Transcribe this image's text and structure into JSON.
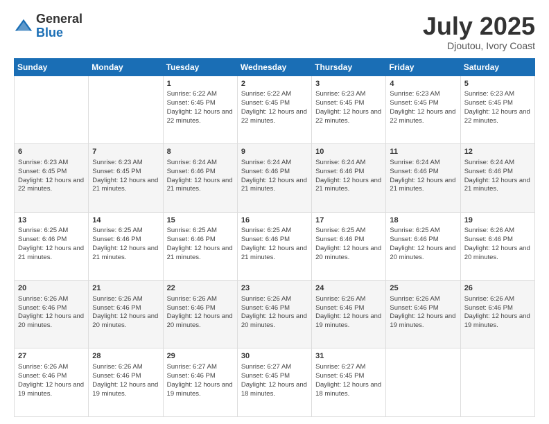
{
  "header": {
    "logo_general": "General",
    "logo_blue": "Blue",
    "month_title": "July 2025",
    "location": "Djoutou, Ivory Coast"
  },
  "weekdays": [
    "Sunday",
    "Monday",
    "Tuesday",
    "Wednesday",
    "Thursday",
    "Friday",
    "Saturday"
  ],
  "weeks": [
    [
      {
        "day": "",
        "info": ""
      },
      {
        "day": "",
        "info": ""
      },
      {
        "day": "1",
        "sunrise": "6:22 AM",
        "sunset": "6:45 PM",
        "daylight": "12 hours and 22 minutes."
      },
      {
        "day": "2",
        "sunrise": "6:22 AM",
        "sunset": "6:45 PM",
        "daylight": "12 hours and 22 minutes."
      },
      {
        "day": "3",
        "sunrise": "6:23 AM",
        "sunset": "6:45 PM",
        "daylight": "12 hours and 22 minutes."
      },
      {
        "day": "4",
        "sunrise": "6:23 AM",
        "sunset": "6:45 PM",
        "daylight": "12 hours and 22 minutes."
      },
      {
        "day": "5",
        "sunrise": "6:23 AM",
        "sunset": "6:45 PM",
        "daylight": "12 hours and 22 minutes."
      }
    ],
    [
      {
        "day": "6",
        "sunrise": "6:23 AM",
        "sunset": "6:45 PM",
        "daylight": "12 hours and 22 minutes."
      },
      {
        "day": "7",
        "sunrise": "6:23 AM",
        "sunset": "6:45 PM",
        "daylight": "12 hours and 21 minutes."
      },
      {
        "day": "8",
        "sunrise": "6:24 AM",
        "sunset": "6:46 PM",
        "daylight": "12 hours and 21 minutes."
      },
      {
        "day": "9",
        "sunrise": "6:24 AM",
        "sunset": "6:46 PM",
        "daylight": "12 hours and 21 minutes."
      },
      {
        "day": "10",
        "sunrise": "6:24 AM",
        "sunset": "6:46 PM",
        "daylight": "12 hours and 21 minutes."
      },
      {
        "day": "11",
        "sunrise": "6:24 AM",
        "sunset": "6:46 PM",
        "daylight": "12 hours and 21 minutes."
      },
      {
        "day": "12",
        "sunrise": "6:24 AM",
        "sunset": "6:46 PM",
        "daylight": "12 hours and 21 minutes."
      }
    ],
    [
      {
        "day": "13",
        "sunrise": "6:25 AM",
        "sunset": "6:46 PM",
        "daylight": "12 hours and 21 minutes."
      },
      {
        "day": "14",
        "sunrise": "6:25 AM",
        "sunset": "6:46 PM",
        "daylight": "12 hours and 21 minutes."
      },
      {
        "day": "15",
        "sunrise": "6:25 AM",
        "sunset": "6:46 PM",
        "daylight": "12 hours and 21 minutes."
      },
      {
        "day": "16",
        "sunrise": "6:25 AM",
        "sunset": "6:46 PM",
        "daylight": "12 hours and 21 minutes."
      },
      {
        "day": "17",
        "sunrise": "6:25 AM",
        "sunset": "6:46 PM",
        "daylight": "12 hours and 20 minutes."
      },
      {
        "day": "18",
        "sunrise": "6:25 AM",
        "sunset": "6:46 PM",
        "daylight": "12 hours and 20 minutes."
      },
      {
        "day": "19",
        "sunrise": "6:26 AM",
        "sunset": "6:46 PM",
        "daylight": "12 hours and 20 minutes."
      }
    ],
    [
      {
        "day": "20",
        "sunrise": "6:26 AM",
        "sunset": "6:46 PM",
        "daylight": "12 hours and 20 minutes."
      },
      {
        "day": "21",
        "sunrise": "6:26 AM",
        "sunset": "6:46 PM",
        "daylight": "12 hours and 20 minutes."
      },
      {
        "day": "22",
        "sunrise": "6:26 AM",
        "sunset": "6:46 PM",
        "daylight": "12 hours and 20 minutes."
      },
      {
        "day": "23",
        "sunrise": "6:26 AM",
        "sunset": "6:46 PM",
        "daylight": "12 hours and 20 minutes."
      },
      {
        "day": "24",
        "sunrise": "6:26 AM",
        "sunset": "6:46 PM",
        "daylight": "12 hours and 19 minutes."
      },
      {
        "day": "25",
        "sunrise": "6:26 AM",
        "sunset": "6:46 PM",
        "daylight": "12 hours and 19 minutes."
      },
      {
        "day": "26",
        "sunrise": "6:26 AM",
        "sunset": "6:46 PM",
        "daylight": "12 hours and 19 minutes."
      }
    ],
    [
      {
        "day": "27",
        "sunrise": "6:26 AM",
        "sunset": "6:46 PM",
        "daylight": "12 hours and 19 minutes."
      },
      {
        "day": "28",
        "sunrise": "6:26 AM",
        "sunset": "6:46 PM",
        "daylight": "12 hours and 19 minutes."
      },
      {
        "day": "29",
        "sunrise": "6:27 AM",
        "sunset": "6:46 PM",
        "daylight": "12 hours and 19 minutes."
      },
      {
        "day": "30",
        "sunrise": "6:27 AM",
        "sunset": "6:45 PM",
        "daylight": "12 hours and 18 minutes."
      },
      {
        "day": "31",
        "sunrise": "6:27 AM",
        "sunset": "6:45 PM",
        "daylight": "12 hours and 18 minutes."
      },
      {
        "day": "",
        "info": ""
      },
      {
        "day": "",
        "info": ""
      }
    ]
  ],
  "labels": {
    "sunrise": "Sunrise:",
    "sunset": "Sunset:",
    "daylight": "Daylight:"
  }
}
